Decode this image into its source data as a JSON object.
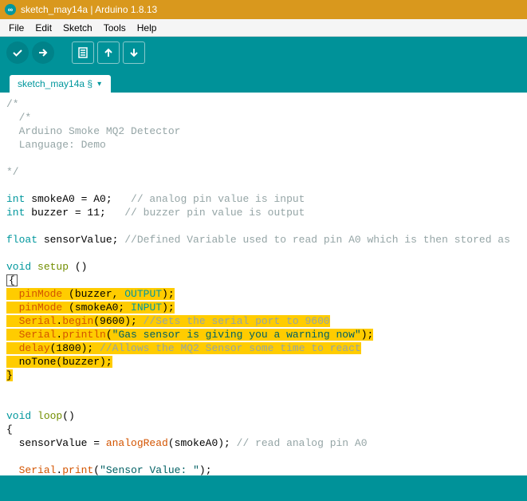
{
  "title": "sketch_may14a | Arduino 1.8.13",
  "menu": {
    "file": "File",
    "edit": "Edit",
    "sketch": "Sketch",
    "tools": "Tools",
    "help": "Help"
  },
  "tab": {
    "name": "sketch_may14a §"
  },
  "code": {
    "c1": "/*",
    "c2": "  /*",
    "c3": "  Arduino Smoke MQ2 Detector",
    "c4": "  Language: Demo",
    "c5": "*/",
    "l1_type": "int",
    "l1_var": " smokeA0 = A0;   ",
    "l1_cmt": "// analog pin value is input",
    "l2_type": "int",
    "l2_var": " buzzer = 11;   ",
    "l2_cmt": "// buzzer pin value is output",
    "l3_type": "float",
    "l3_var": " sensorValue; ",
    "l3_cmt": "//Defined Variable used to read pin A0 which is then stored as",
    "l4_void": "void",
    "l4_fn": " setup",
    "l4_rest": " ()",
    "l5": "{",
    "h1_a": "  ",
    "h1_fn": "pinMode",
    "h1_b": " (buzzer, ",
    "h1_c": "OUTPUT",
    "h1_d": ");",
    "h2_a": "  ",
    "h2_fn": "pinMode",
    "h2_b": " (smokeA0; ",
    "h2_c": "INPUT",
    "h2_d": ");",
    "h3_a": "  ",
    "h3_o": "Serial",
    "h3_b": ".",
    "h3_fn": "begin",
    "h3_c": "(9600); ",
    "h3_cmt": "//Sets the serial port to 9600",
    "h4_a": "  ",
    "h4_o": "Serial",
    "h4_b": ".",
    "h4_fn": "println",
    "h4_c": "(",
    "h4_s": "\"Gas sensor is giving you a warning now\"",
    "h4_d": ");",
    "h5_a": "  ",
    "h5_fn": "delay",
    "h5_b": "(1800); ",
    "h5_cmt": "//Allows the MQ2 Sensor some time to react",
    "h6_a": "  noTone(buzzer);",
    "h7": "}",
    "lp_void": "void",
    "lp_fn": " loop",
    "lp_rest": "()",
    "lp_brace": "{",
    "lp1a": "  sensorValue = ",
    "lp1fn": "analogRead",
    "lp1b": "(smokeA0); ",
    "lp1cmt": "// read analog pin A0",
    "lp2a": "  ",
    "lp2o": "Serial",
    "lp2b": ".",
    "lp2fn": "print",
    "lp2c": "(",
    "lp2s": "\"Sensor Value: \"",
    "lp2d": ");"
  }
}
